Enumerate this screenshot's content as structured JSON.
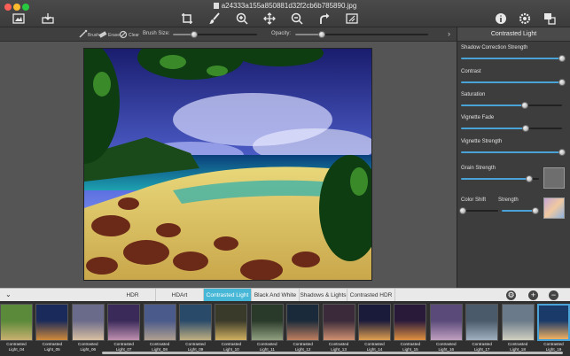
{
  "window": {
    "title": "a24333a155a850881d32f2cb6b785890.jpg"
  },
  "toolbar": {
    "icons": [
      "open-image-icon",
      "export-icon",
      "crop-icon",
      "brush-icon",
      "zoom-in-icon",
      "move-icon",
      "zoom-out-icon",
      "redo-icon",
      "compare-icon",
      "info-icon",
      "settings-icon",
      "share-icon"
    ]
  },
  "subbar": {
    "tool1": "Brush",
    "tool2": "Erase",
    "tool3": "Clear",
    "brush_size_label": "Brush Size:",
    "brush_size_value": 0.25,
    "opacity_label": "Opacity:",
    "opacity_value": 0.2
  },
  "panel": {
    "title": "Contrasted Light",
    "controls": [
      {
        "label": "Shadow Correction Strength",
        "value": 1.0
      },
      {
        "label": "Contrast",
        "value": 1.0
      },
      {
        "label": "Saturation",
        "value": 0.63
      },
      {
        "label": "Vignette Fade",
        "value": 0.64
      },
      {
        "label": "Vignette Strength",
        "value": 1.0
      }
    ],
    "grain_label": "Grain Strength",
    "grain_value": 0.88,
    "color_shift_label": "Color Shift",
    "color_shift_value": 0.05,
    "strength_label": "Strength",
    "strength_value": 0.9,
    "colors": {
      "accent": "#4aa3d6",
      "grain_swatch": "#6e6e6e"
    }
  },
  "tabs": [
    {
      "label": "HDR",
      "active": false
    },
    {
      "label": "HDArt",
      "active": false
    },
    {
      "label": "Contrasted Light",
      "active": true
    },
    {
      "label": "Black And White",
      "active": false
    },
    {
      "label": "Shadows & Lights",
      "active": false
    },
    {
      "label": "Contrasted HDR",
      "active": false
    }
  ],
  "thumbnails": [
    {
      "line1": "Contrasted",
      "line2": "Light_04"
    },
    {
      "line1": "Contrasted",
      "line2": "Light_05"
    },
    {
      "line1": "Contrasted",
      "line2": "Light_06"
    },
    {
      "line1": "Contrasted",
      "line2": "Light_07"
    },
    {
      "line1": "Contrasted",
      "line2": "Light_08"
    },
    {
      "line1": "Contrasted",
      "line2": "Light_09"
    },
    {
      "line1": "Contrasted",
      "line2": "Light_10"
    },
    {
      "line1": "Contrasted",
      "line2": "Light_11"
    },
    {
      "line1": "Contrasted",
      "line2": "Light_12"
    },
    {
      "line1": "Contrasted",
      "line2": "Light_13"
    },
    {
      "line1": "Contrasted",
      "line2": "Light_14"
    },
    {
      "line1": "Contrasted",
      "line2": "Light_15"
    },
    {
      "line1": "Contrasted",
      "line2": "Light_16"
    },
    {
      "line1": "Contrasted",
      "line2": "Light_17"
    },
    {
      "line1": "Contrasted",
      "line2": "Light_18"
    },
    {
      "line1": "Contrasted",
      "line2": "Light_19"
    }
  ],
  "selected_thumbnail": "Light_19"
}
